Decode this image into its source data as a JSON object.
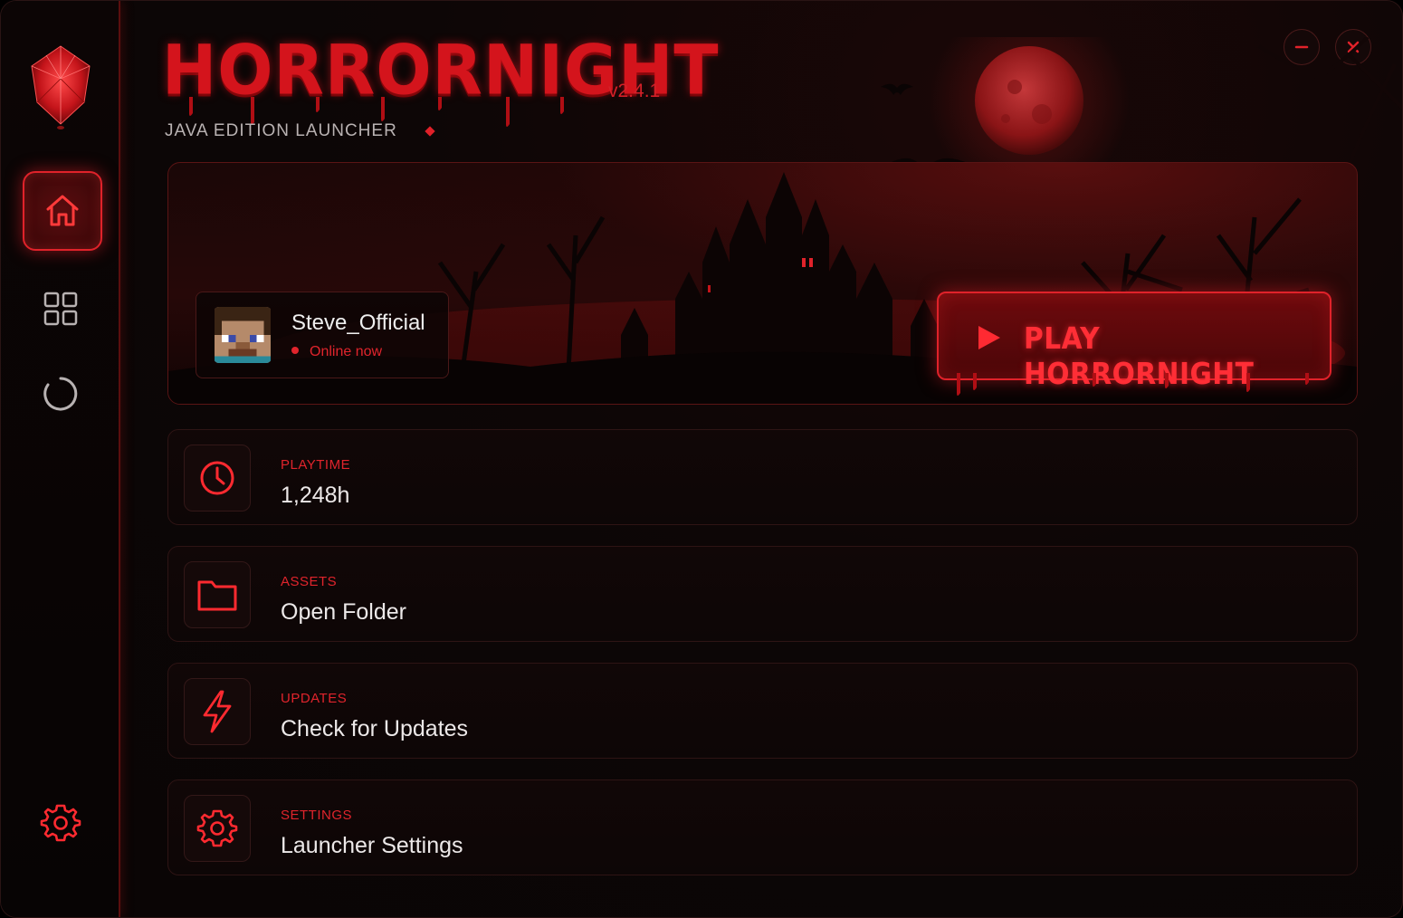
{
  "app": {
    "title": "HORRORNIGHT",
    "version": "v2.4.1",
    "subtitle": "JAVA EDITION LAUNCHER"
  },
  "window_controls": {
    "minimize_icon": "minus-icon",
    "close_icon": "close-icon"
  },
  "sidebar": {
    "logo_icon": "red-crystal-icon",
    "items": [
      {
        "name": "home",
        "icon": "home-icon",
        "active": true
      },
      {
        "name": "grid",
        "icon": "grid-icon",
        "active": false
      },
      {
        "name": "loading",
        "icon": "spinner-icon",
        "active": false
      }
    ],
    "bottom_icon": "gear-icon"
  },
  "profile": {
    "username": "Steve_Official",
    "status": "Online now"
  },
  "play_button": {
    "label": "PLAY HORRORNIGHT"
  },
  "rows": [
    {
      "kicker": "PLAYTIME",
      "title": "1,248h",
      "icon": "clock-icon"
    },
    {
      "kicker": "ASSETS",
      "title": "Open Folder",
      "icon": "folder-icon"
    },
    {
      "kicker": "UPDATES",
      "title": "Check for Updates",
      "icon": "lightning-icon"
    },
    {
      "kicker": "SETTINGS",
      "title": "Launcher Settings",
      "icon": "gear-icon"
    }
  ],
  "colors": {
    "accent": "#e0222a",
    "background": "#0a0505",
    "text": "#ece8e8"
  }
}
